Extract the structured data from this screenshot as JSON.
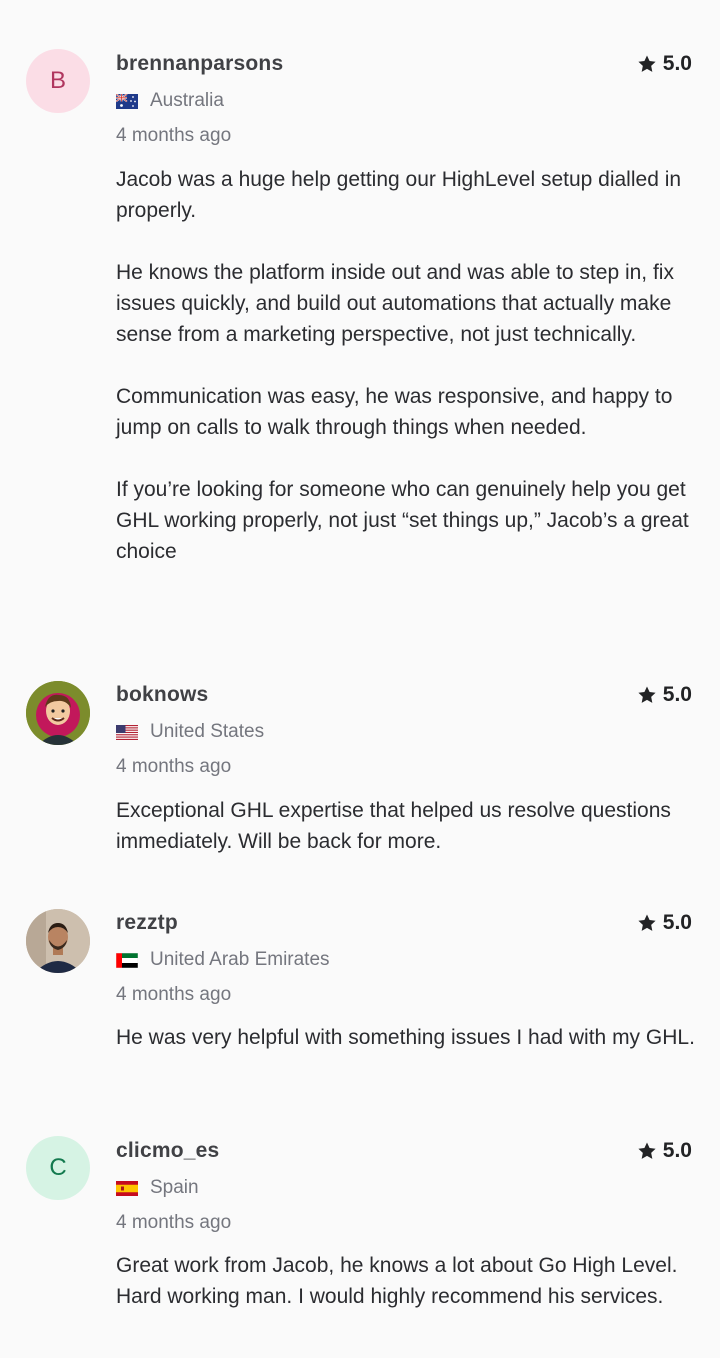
{
  "reviews": [
    {
      "avatar_letter": "B",
      "avatar_type": "letter",
      "avatar_color": "#fbdde6",
      "username": "brennanparsons",
      "country": "Australia",
      "flag_icon": "australia-flag-icon",
      "rating": "5.0",
      "time": "4 months ago",
      "text": "Jacob was a huge help getting our HighLevel setup dialled in properly.\n\nHe knows the platform inside out and was able to step in, fix issues quickly, and build out automations that actually make sense from a marketing perspective, not just technically.\n\nCommunication was easy, he was responsive, and happy to jump on calls to walk through things when needed.\n\nIf you’re looking for someone who can genuinely help you get GHL working properly, not just “set things up,” Jacob’s a great choice"
    },
    {
      "avatar_type": "photo",
      "avatar_icon": "cartoon-avatar-icon",
      "username": "boknows",
      "country": "United States",
      "flag_icon": "united-states-flag-icon",
      "rating": "5.0",
      "time": "4 months ago",
      "text": "Exceptional GHL expertise that helped us resolve questions immediately. Will be back for more."
    },
    {
      "avatar_type": "photo",
      "avatar_icon": "person-photo-avatar-icon",
      "username": "rezztp",
      "country": "United Arab Emirates",
      "flag_icon": "uae-flag-icon",
      "rating": "5.0",
      "time": "4 months ago",
      "text": "He was very helpful with something issues I had with my GHL."
    },
    {
      "avatar_letter": "C",
      "avatar_type": "letter",
      "avatar_color": "#d6f3e4",
      "username": "clicmo_es",
      "country": "Spain",
      "flag_icon": "spain-flag-icon",
      "rating": "5.0",
      "time": "4 months ago",
      "text": "Great work from Jacob, he knows a lot about Go High Level. Hard working man. I would highly recommend his services."
    }
  ]
}
